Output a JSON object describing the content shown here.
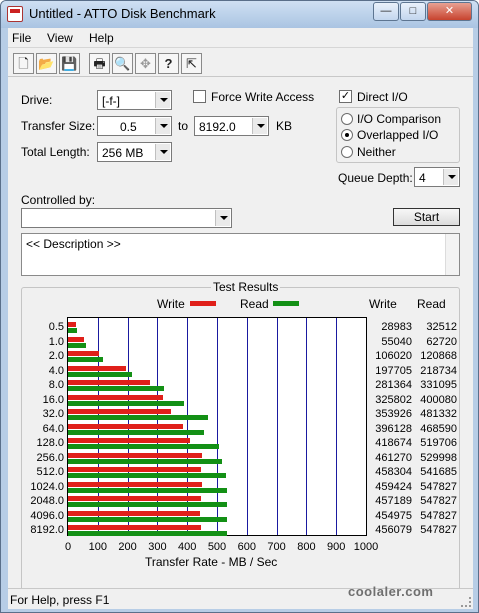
{
  "window": {
    "title": "Untitled - ATTO Disk Benchmark",
    "buttons": {
      "minimize": "—",
      "maximize": "□",
      "close": "✕"
    }
  },
  "menu": [
    "File",
    "View",
    "Help"
  ],
  "toolbar": {
    "icons": [
      "new-file-icon",
      "open-folder-icon",
      "save-icon",
      "print-icon",
      "print-preview-icon",
      "move-icon",
      "help-icon",
      "context-help-icon"
    ],
    "glyphs": [
      "🗋",
      "📂",
      "💾",
      "🖶",
      "🔍",
      "✥",
      "?",
      "⇱"
    ]
  },
  "settings": {
    "drive_label": "Drive:",
    "drive_value": "[-f-]",
    "force_write_label": "Force Write Access",
    "force_write_checked": false,
    "direct_io_label": "Direct I/O",
    "direct_io_checked": true,
    "transfer_size_label": "Transfer Size:",
    "transfer_from": "0.5",
    "to_label": "to",
    "transfer_to": "8192.0",
    "kb_label": "KB",
    "total_length_label": "Total Length:",
    "total_length_value": "256 MB",
    "io_comparison_label": "I/O Comparison",
    "overlapped_io_label": "Overlapped I/O",
    "neither_label": "Neither",
    "selected_mode": "Overlapped I/O",
    "queue_depth_label": "Queue Depth:",
    "queue_depth_value": "4",
    "controlled_by_label": "Controlled by:",
    "controlled_by_value": "",
    "start_label": "Start",
    "description": "<< Description >>"
  },
  "chart_data": {
    "type": "bar",
    "title": "Test Results",
    "legend": [
      "Write",
      "Read"
    ],
    "legend_placement": "top",
    "xlabel": "Transfer Rate - MB / Sec",
    "xlim": [
      0,
      1000
    ],
    "xticks": [
      "0",
      "100",
      "200",
      "300",
      "400",
      "500",
      "600",
      "700",
      "800",
      "900",
      "1000"
    ],
    "categories": [
      "0.5",
      "1.0",
      "2.0",
      "4.0",
      "8.0",
      "16.0",
      "32.0",
      "64.0",
      "128.0",
      "256.0",
      "512.0",
      "1024.0",
      "2048.0",
      "4096.0",
      "8192.0"
    ],
    "table_headers": [
      "Write",
      "Read"
    ],
    "series": [
      {
        "name": "Write",
        "color": "#e0201a",
        "values": [
          28983,
          55040,
          106020,
          197705,
          281364,
          325802,
          353926,
          396128,
          418674,
          461270,
          458304,
          459424,
          457189,
          454975,
          456079
        ]
      },
      {
        "name": "Read",
        "color": "#139015",
        "values": [
          32512,
          62720,
          120868,
          218734,
          331095,
          400080,
          481332,
          468590,
          519706,
          529998,
          541685,
          547827,
          547827,
          547827,
          547827
        ]
      }
    ]
  },
  "status": {
    "text": "For Help, press F1"
  },
  "watermark": "coolaler.com"
}
